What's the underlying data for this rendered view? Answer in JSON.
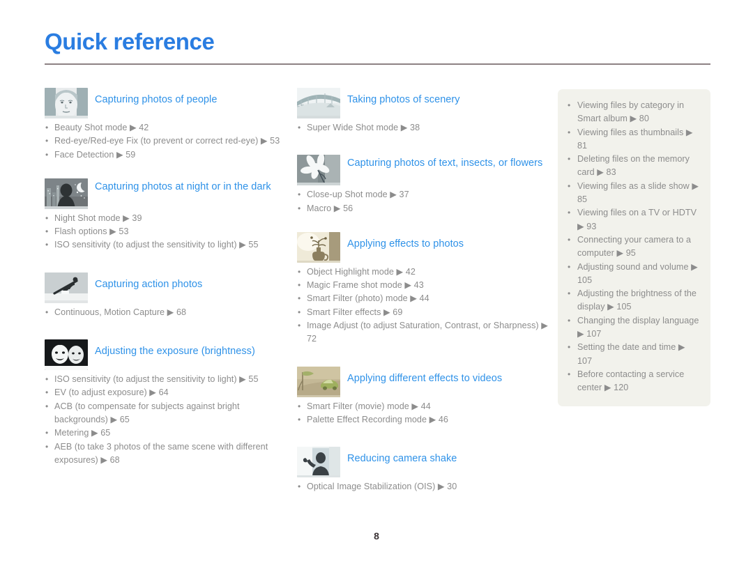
{
  "page": {
    "title": "Quick reference",
    "number": "8",
    "accent_color": "#2a7de1",
    "heading_color": "#2f92e8",
    "body_color": "#8c8c8c",
    "rule_color": "#8d8183",
    "panel_bg": "#f2f2ec"
  },
  "columns": {
    "left": [
      {
        "icon": "portrait-face-thumbnail",
        "title": "Capturing photos of people",
        "items": [
          "Beauty Shot mode ▶ 42",
          "Red-eye/Red-eye Fix (to prevent or correct red-eye) ▶ 53",
          "Face Detection ▶ 59"
        ]
      },
      {
        "icon": "night-silhouette-moon-thumbnail",
        "title": "Capturing photos at night or in the dark",
        "items": [
          "Night Shot mode ▶ 39",
          "Flash options ▶ 53",
          "ISO sensitivity (to adjust the sensitivity to light) ▶ 55"
        ]
      },
      {
        "icon": "snowboarder-action-thumbnail",
        "title": "Capturing action photos",
        "items": [
          "Continuous, Motion Capture ▶ 68"
        ]
      },
      {
        "icon": "two-faces-exposure-thumbnail",
        "title": "Adjusting the exposure (brightness)",
        "items": [
          "ISO sensitivity (to adjust the sensitivity to light) ▶ 55",
          "EV (to adjust exposure) ▶ 64",
          "ACB (to compensate for subjects against bright backgrounds) ▶ 65",
          "Metering ▶ 65",
          "AEB (to take 3 photos of the same scene with different exposures) ▶ 68"
        ]
      }
    ],
    "middle": [
      {
        "icon": "bridge-skyline-scenery-thumbnail",
        "title": "Taking photos of scenery",
        "items": [
          "Super Wide Shot mode ▶ 38"
        ]
      },
      {
        "icon": "white-flower-macro-thumbnail",
        "title": "Capturing  photos of text, insects, or flowers",
        "items": [
          "Close-up Shot mode ▶ 37",
          "Macro ▶ 56"
        ]
      },
      {
        "icon": "vase-sepia-effect-thumbnail",
        "title": "Applying effects to photos",
        "items": [
          "Object Highlight mode ▶ 42",
          "Magic Frame shot mode ▶ 43",
          "Smart Filter (photo) mode ▶ 44",
          "Smart Filter effects ▶ 69",
          "Image Adjust (to adjust Saturation, Contrast, or Sharpness) ▶ 72"
        ]
      },
      {
        "icon": "green-car-video-effect-thumbnail",
        "title": "Applying different effects to videos",
        "items": [
          "Smart Filter (movie) mode ▶ 44",
          "Palette Effect Recording mode ▶ 46"
        ]
      },
      {
        "icon": "person-waving-shake-thumbnail",
        "title": "Reducing camera shake",
        "items": [
          "Optical Image Stabilization (OIS) ▶ 30"
        ]
      }
    ]
  },
  "panel": {
    "items": [
      "Viewing files by category in Smart album ▶ 80",
      "Viewing files as thumbnails ▶ 81",
      "Deleting files on the memory card ▶ 83",
      "Viewing files as a slide show ▶ 85",
      "Viewing files on a TV or HDTV ▶ 93",
      "Connecting your camera to a computer ▶ 95",
      "Adjusting sound and volume ▶ 105",
      "Adjusting the brightness of the display ▶ 105",
      "Changing the display language ▶ 107",
      "Setting the date and time ▶ 107",
      "Before contacting a service center ▶ 120"
    ]
  }
}
